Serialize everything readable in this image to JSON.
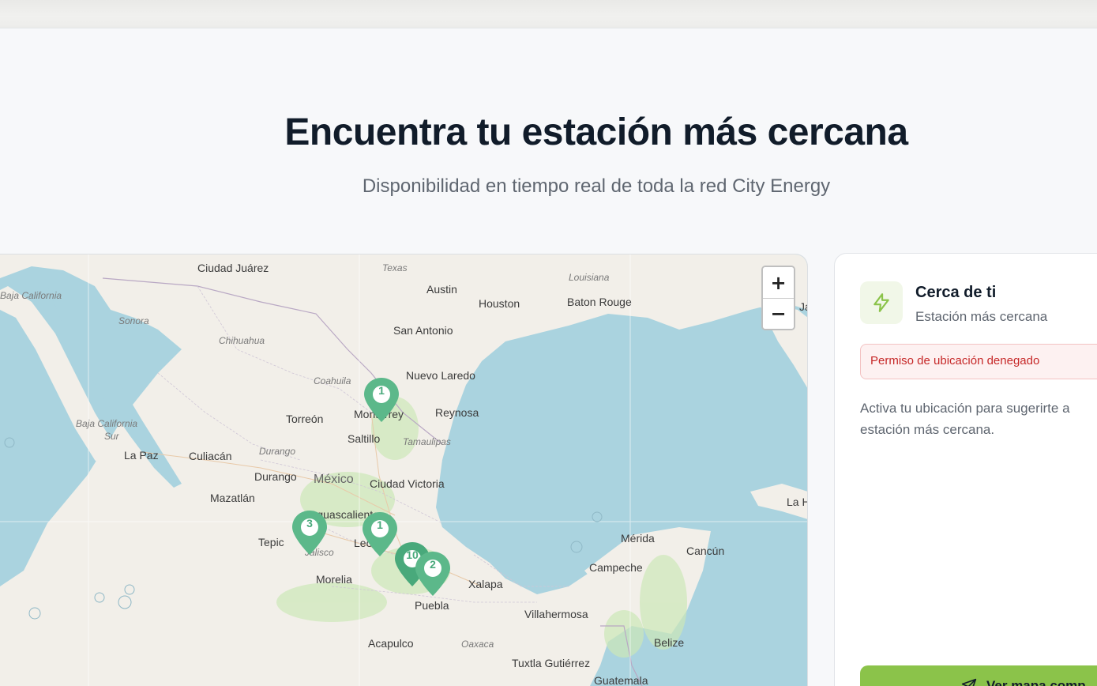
{
  "hero": {
    "title": "Encuentra tu estación más cercana",
    "subtitle": "Disponibilidad en tiempo real de toda la red City Energy"
  },
  "map": {
    "labels": {
      "ciudad_juarez": "Ciudad Juárez",
      "texas": "Texas",
      "louisiana": "Louisiana",
      "baja_california": "Baja California",
      "austin": "Austin",
      "houston": "Houston",
      "baton_rouge": "Baton Rouge",
      "jacksonville": "Ja",
      "sonora": "Sonora",
      "chihuahua": "Chihuahua",
      "san_antonio": "San Antonio",
      "nuevo_laredo": "Nuevo Laredo",
      "coahuila": "Coahuila",
      "monterrey": "Monterrey",
      "reynosa": "Reynosa",
      "torreon": "Torreón",
      "baja_california_sur_1": "Baja California",
      "baja_california_sur_2": "Sur",
      "saltillo": "Saltillo",
      "tamaulipas": "Tamaulipas",
      "la_paz": "La Paz",
      "culiacan": "Culiacán",
      "durango_state": "Durango",
      "durango": "Durango",
      "mexico": "México",
      "ciudad_victoria": "Ciudad Victoria",
      "mazatlan": "Mazatlán",
      "aguascalientes": "Aguascalientes",
      "tepic": "Tepic",
      "jalisco": "Jalisco",
      "leon": "León",
      "merida": "Mérida",
      "cancun": "Cancún",
      "la_habana": "La H",
      "morelia": "Morelia",
      "campeche": "Campeche",
      "xalapa": "Xalapa",
      "puebla": "Puebla",
      "villahermosa": "Villahermosa",
      "belize": "Belize",
      "acapulco": "Acapulco",
      "oaxaca": "Oaxaca",
      "tuxtla": "Tuxtla Gutiérrez",
      "guatemala": "Guatemala"
    },
    "zoom": {
      "in_label": "+",
      "out_label": "−"
    },
    "markers": [
      {
        "count": "1",
        "color": "#5cb88a"
      },
      {
        "count": "3",
        "color": "#5cb88a"
      },
      {
        "count": "1",
        "color": "#5cb88a"
      },
      {
        "count": "10",
        "color": "#49a97b"
      },
      {
        "count": "2",
        "color": "#5cb88a"
      }
    ]
  },
  "panel": {
    "title": "Cerca de ti",
    "subtitle": "Estación más cercana",
    "alert": "Permiso de ubicación denegado",
    "text": "Activa tu ubicación para sugerirte a estación más cercana.",
    "cta_label": "Ver mapa comp",
    "accent": "#8bc34a",
    "icon": "lightning-icon",
    "cta_icon": "send-icon"
  }
}
